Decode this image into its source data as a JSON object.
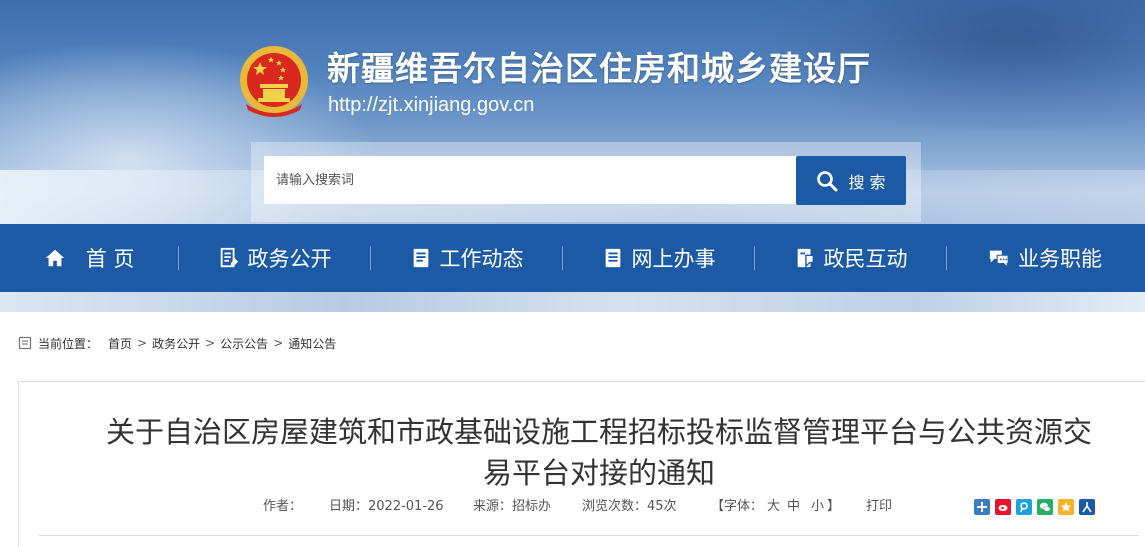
{
  "header": {
    "site_title": "新疆维吾尔自治区住房和城乡建设厅",
    "site_url": "http://zjt.xinjiang.gov.cn"
  },
  "search": {
    "placeholder": "请输入搜索词",
    "button_label": "搜 索"
  },
  "nav": {
    "items": [
      {
        "label": "首 页",
        "icon": "home-icon"
      },
      {
        "label": "政务公开",
        "icon": "document-icon"
      },
      {
        "label": "工作动态",
        "icon": "news-icon"
      },
      {
        "label": "网上办事",
        "icon": "service-icon"
      },
      {
        "label": "政民互动",
        "icon": "interaction-icon"
      },
      {
        "label": "业务职能",
        "icon": "chat-icon"
      }
    ]
  },
  "breadcrumb": {
    "label": "当前位置：",
    "items": [
      "首页",
      "政务公开",
      "公示公告",
      "通知公告"
    ],
    "separator": ">"
  },
  "article": {
    "title_line1": "关于自治区房屋建筑和市政基础设施工程招标投标监督管理平台与公共资源交",
    "title_line2": "易平台对接的通知",
    "author_label": "作者：",
    "date_label": "日期：2022-01-26",
    "source_label": "来源：招标办",
    "views_label": "浏览次数：45次",
    "font_label": "【字体：",
    "font_large": "大",
    "font_medium": "中",
    "font_small": "小",
    "font_close": "】",
    "print_label": "打印"
  },
  "colors": {
    "nav_bg": "#1d5aa6",
    "search_button": "#1d5aa6"
  }
}
